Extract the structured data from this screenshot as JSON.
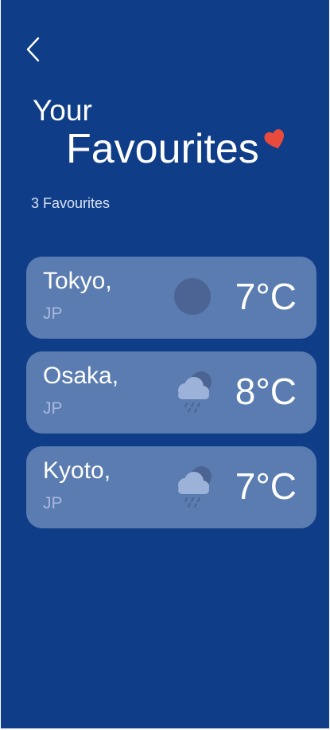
{
  "header": {
    "back_icon": "chevron-left-icon",
    "title_line_1": "Your",
    "title_line_2": "Favourites",
    "heart_icon": "heart-icon",
    "heart_color": "#e84a3c"
  },
  "summary": {
    "count_text": "3 Favourites"
  },
  "favourites": [
    {
      "city": "Tokyo,",
      "country": "JP",
      "temperature": "7°C",
      "weather_icon": "moon-icon"
    },
    {
      "city": "Osaka,",
      "country": "JP",
      "temperature": "8°C",
      "weather_icon": "cloud-rain-moon-icon"
    },
    {
      "city": "Kyoto,",
      "country": "JP",
      "temperature": "7°C",
      "weather_icon": "cloud-rain-moon-icon"
    }
  ],
  "colors": {
    "background": "#0f3d87",
    "card": "#5a7cb0",
    "country_text": "#a9b7e0"
  }
}
